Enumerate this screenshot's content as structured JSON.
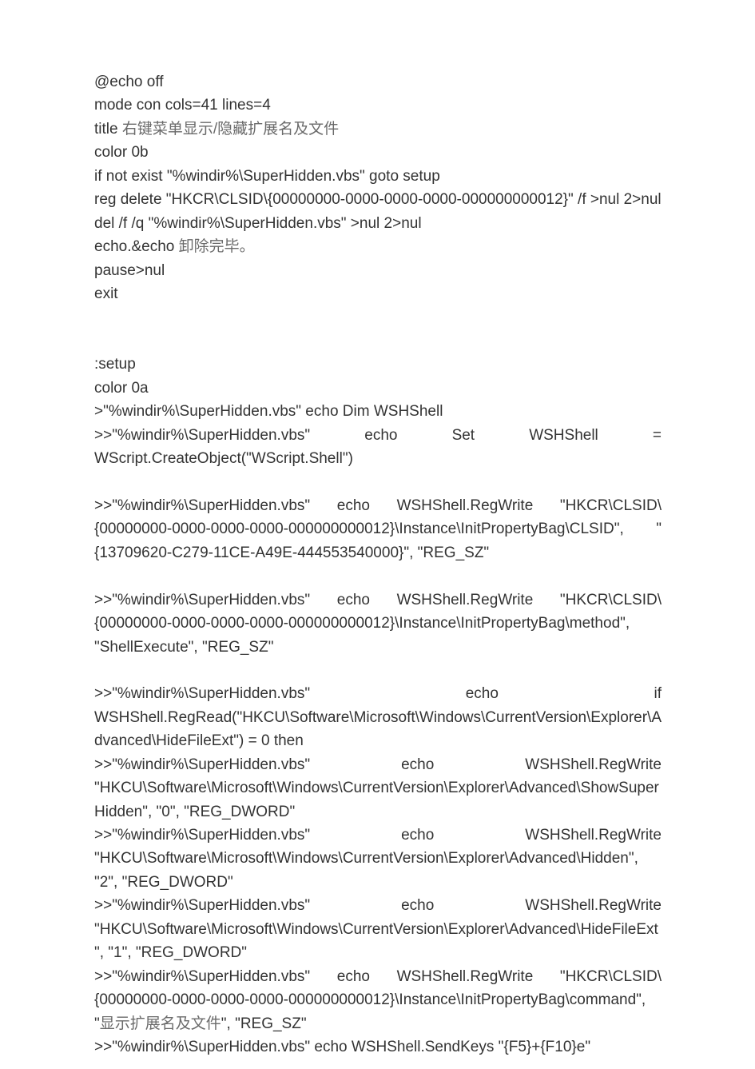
{
  "lines": [
    {
      "text": "@echo off",
      "cls": "line"
    },
    {
      "text": "mode con cols=41 lines=4",
      "cls": "line"
    },
    {
      "segments": [
        {
          "t": "title ",
          "cls": ""
        },
        {
          "t": "右键菜单显示/隐藏扩展名及文件",
          "cls": "cn"
        }
      ],
      "cls": "line"
    },
    {
      "text": "color 0b",
      "cls": "line"
    },
    {
      "text": "if not exist \"%windir%\\SuperHidden.vbs\" goto setup",
      "cls": "line"
    },
    {
      "text": "reg delete \"HKCR\\CLSID\\{00000000-0000-0000-0000-000000000012}\" /f >nul 2>nul",
      "cls": "line justify-left"
    },
    {
      "text": "del /f /q \"%windir%\\SuperHidden.vbs\" >nul 2>nul",
      "cls": "line"
    },
    {
      "segments": [
        {
          "t": "echo.&echo ",
          "cls": ""
        },
        {
          "t": "卸除完毕。",
          "cls": "cn"
        }
      ],
      "cls": "line"
    },
    {
      "text": "pause>nul",
      "cls": "line"
    },
    {
      "text": "exit",
      "cls": "line"
    },
    {
      "blank": true,
      "cls": "blank"
    },
    {
      "blank": true,
      "cls": "blank"
    },
    {
      "text": ":setup",
      "cls": "line"
    },
    {
      "text": "color 0a",
      "cls": "line"
    },
    {
      "text": ">\"%windir%\\SuperHidden.vbs\" echo Dim WSHShell",
      "cls": "line"
    },
    {
      "text": ">>\"%windir%\\SuperHidden.vbs\" echo Set WSHShell = WScript.CreateObject(\"WScript.Shell\")",
      "cls": "line justify-left"
    },
    {
      "blank": true,
      "cls": "blank"
    },
    {
      "text": ">>\"%windir%\\SuperHidden.vbs\" echo WSHShell.RegWrite \"HKCR\\CLSID\\{00000000-0000-0000-0000-000000000012}\\Instance\\InitPropertyBag\\CLSID\", \"{13709620-C279-11CE-A49E-444553540000}\", \"REG_SZ\"",
      "cls": "line justify-left"
    },
    {
      "blank": true,
      "cls": "blank"
    },
    {
      "text": ">>\"%windir%\\SuperHidden.vbs\" echo WSHShell.RegWrite \"HKCR\\CLSID\\{00000000-0000-0000-0000-000000000012}\\Instance\\InitPropertyBag\\method\", \"ShellExecute\", \"REG_SZ\"",
      "cls": "line justify-left"
    },
    {
      "blank": true,
      "cls": "blank"
    },
    {
      "text": ">>\"%windir%\\SuperHidden.vbs\" echo if WSHShell.RegRead(\"HKCU\\Software\\Microsoft\\Windows\\CurrentVersion\\Explorer\\Advanced\\HideFileExt\") = 0 then",
      "cls": "line justify-left"
    },
    {
      "text": ">>\"%windir%\\SuperHidden.vbs\" echo WSHShell.RegWrite \"HKCU\\Software\\Microsoft\\Windows\\CurrentVersion\\Explorer\\Advanced\\ShowSuperHidden\", \"0\", \"REG_DWORD\"",
      "cls": "line justify-left"
    },
    {
      "text": ">>\"%windir%\\SuperHidden.vbs\" echo WSHShell.RegWrite \"HKCU\\Software\\Microsoft\\Windows\\CurrentVersion\\Explorer\\Advanced\\Hidden\", \"2\", \"REG_DWORD\"",
      "cls": "line justify-left"
    },
    {
      "text": ">>\"%windir%\\SuperHidden.vbs\" echo WSHShell.RegWrite \"HKCU\\Software\\Microsoft\\Windows\\CurrentVersion\\Explorer\\Advanced\\HideFileExt\", \"1\", \"REG_DWORD\"",
      "cls": "line justify-left"
    },
    {
      "segments": [
        {
          "t": ">>\"%windir%\\SuperHidden.vbs\" echo WSHShell.RegWrite \"HKCR\\CLSID\\{00000000-0000-0000-0000-000000000012}\\Instance\\InitPropertyBag\\command\", \"",
          "cls": ""
        },
        {
          "t": "显示扩展名及文件",
          "cls": "cn"
        },
        {
          "t": "\", \"REG_SZ\"",
          "cls": ""
        }
      ],
      "cls": "line justify-left"
    },
    {
      "text": ">>\"%windir%\\SuperHidden.vbs\" echo WSHShell.SendKeys \"{F5}+{F10}e\"",
      "cls": "line"
    }
  ]
}
